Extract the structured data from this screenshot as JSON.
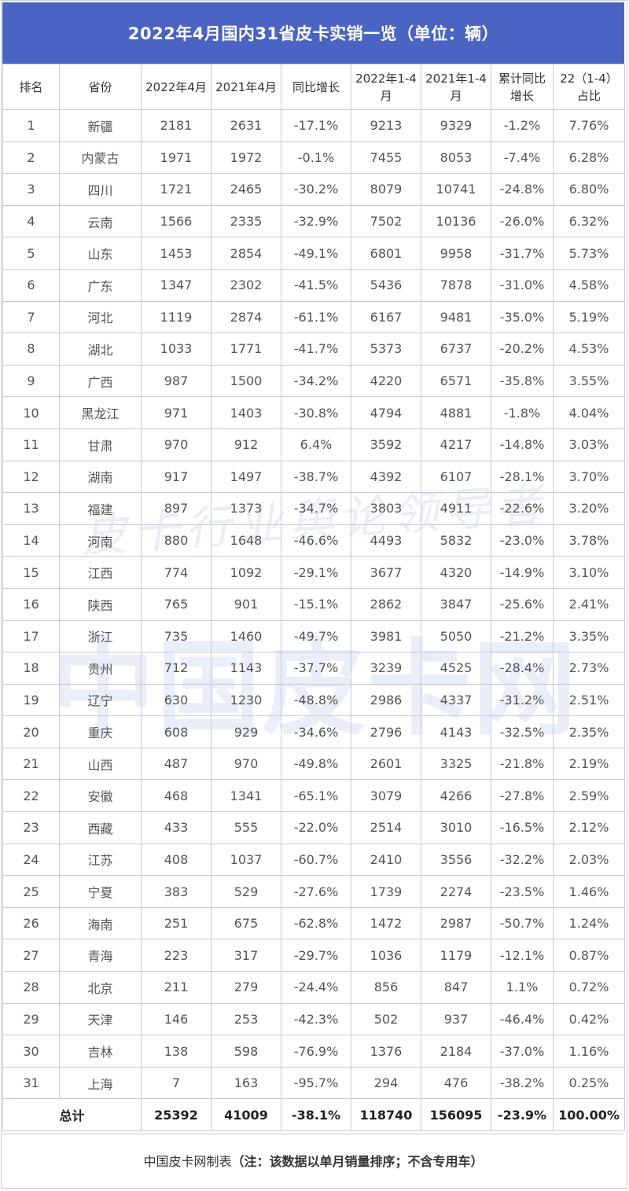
{
  "title": "2022年4月国内31省皮卡实销一览（单位：辆）",
  "watermark": {
    "brand": "中国皮卡网",
    "script": "皮卡行业舆论领导者"
  },
  "headers": [
    "排名",
    "省份",
    "2022年4月",
    "2021年4月",
    "同比增长",
    "2022年1-4月",
    "2021年1-4月",
    "累计同比增长",
    "22（1-4）占比"
  ],
  "rows": [
    {
      "rank": "1",
      "prov": "新疆",
      "m22": "2181",
      "m21": "2631",
      "yoy": "-17.1%",
      "c22": "9213",
      "c21": "9329",
      "cyoy": "-1.2%",
      "share": "7.76%"
    },
    {
      "rank": "2",
      "prov": "内蒙古",
      "m22": "1971",
      "m21": "1972",
      "yoy": "-0.1%",
      "c22": "7455",
      "c21": "8053",
      "cyoy": "-7.4%",
      "share": "6.28%"
    },
    {
      "rank": "3",
      "prov": "四川",
      "m22": "1721",
      "m21": "2465",
      "yoy": "-30.2%",
      "c22": "8079",
      "c21": "10741",
      "cyoy": "-24.8%",
      "share": "6.80%"
    },
    {
      "rank": "4",
      "prov": "云南",
      "m22": "1566",
      "m21": "2335",
      "yoy": "-32.9%",
      "c22": "7502",
      "c21": "10136",
      "cyoy": "-26.0%",
      "share": "6.32%"
    },
    {
      "rank": "5",
      "prov": "山东",
      "m22": "1453",
      "m21": "2854",
      "yoy": "-49.1%",
      "c22": "6801",
      "c21": "9958",
      "cyoy": "-31.7%",
      "share": "5.73%"
    },
    {
      "rank": "6",
      "prov": "广东",
      "m22": "1347",
      "m21": "2302",
      "yoy": "-41.5%",
      "c22": "5436",
      "c21": "7878",
      "cyoy": "-31.0%",
      "share": "4.58%"
    },
    {
      "rank": "7",
      "prov": "河北",
      "m22": "1119",
      "m21": "2874",
      "yoy": "-61.1%",
      "c22": "6167",
      "c21": "9481",
      "cyoy": "-35.0%",
      "share": "5.19%"
    },
    {
      "rank": "8",
      "prov": "湖北",
      "m22": "1033",
      "m21": "1771",
      "yoy": "-41.7%",
      "c22": "5373",
      "c21": "6737",
      "cyoy": "-20.2%",
      "share": "4.53%"
    },
    {
      "rank": "9",
      "prov": "广西",
      "m22": "987",
      "m21": "1500",
      "yoy": "-34.2%",
      "c22": "4220",
      "c21": "6571",
      "cyoy": "-35.8%",
      "share": "3.55%"
    },
    {
      "rank": "10",
      "prov": "黑龙江",
      "m22": "971",
      "m21": "1403",
      "yoy": "-30.8%",
      "c22": "4794",
      "c21": "4881",
      "cyoy": "-1.8%",
      "share": "4.04%"
    },
    {
      "rank": "11",
      "prov": "甘肃",
      "m22": "970",
      "m21": "912",
      "yoy": "6.4%",
      "c22": "3592",
      "c21": "4217",
      "cyoy": "-14.8%",
      "share": "3.03%"
    },
    {
      "rank": "12",
      "prov": "湖南",
      "m22": "917",
      "m21": "1497",
      "yoy": "-38.7%",
      "c22": "4392",
      "c21": "6107",
      "cyoy": "-28.1%",
      "share": "3.70%"
    },
    {
      "rank": "13",
      "prov": "福建",
      "m22": "897",
      "m21": "1373",
      "yoy": "-34.7%",
      "c22": "3803",
      "c21": "4911",
      "cyoy": "-22.6%",
      "share": "3.20%"
    },
    {
      "rank": "14",
      "prov": "河南",
      "m22": "880",
      "m21": "1648",
      "yoy": "-46.6%",
      "c22": "4493",
      "c21": "5832",
      "cyoy": "-23.0%",
      "share": "3.78%"
    },
    {
      "rank": "15",
      "prov": "江西",
      "m22": "774",
      "m21": "1092",
      "yoy": "-29.1%",
      "c22": "3677",
      "c21": "4320",
      "cyoy": "-14.9%",
      "share": "3.10%"
    },
    {
      "rank": "16",
      "prov": "陕西",
      "m22": "765",
      "m21": "901",
      "yoy": "-15.1%",
      "c22": "2862",
      "c21": "3847",
      "cyoy": "-25.6%",
      "share": "2.41%"
    },
    {
      "rank": "17",
      "prov": "浙江",
      "m22": "735",
      "m21": "1460",
      "yoy": "-49.7%",
      "c22": "3981",
      "c21": "5050",
      "cyoy": "-21.2%",
      "share": "3.35%"
    },
    {
      "rank": "18",
      "prov": "贵州",
      "m22": "712",
      "m21": "1143",
      "yoy": "-37.7%",
      "c22": "3239",
      "c21": "4525",
      "cyoy": "-28.4%",
      "share": "2.73%"
    },
    {
      "rank": "19",
      "prov": "辽宁",
      "m22": "630",
      "m21": "1230",
      "yoy": "-48.8%",
      "c22": "2986",
      "c21": "4337",
      "cyoy": "-31.2%",
      "share": "2.51%"
    },
    {
      "rank": "20",
      "prov": "重庆",
      "m22": "608",
      "m21": "929",
      "yoy": "-34.6%",
      "c22": "2796",
      "c21": "4143",
      "cyoy": "-32.5%",
      "share": "2.35%"
    },
    {
      "rank": "21",
      "prov": "山西",
      "m22": "487",
      "m21": "970",
      "yoy": "-49.8%",
      "c22": "2601",
      "c21": "3325",
      "cyoy": "-21.8%",
      "share": "2.19%"
    },
    {
      "rank": "22",
      "prov": "安徽",
      "m22": "468",
      "m21": "1341",
      "yoy": "-65.1%",
      "c22": "3079",
      "c21": "4266",
      "cyoy": "-27.8%",
      "share": "2.59%"
    },
    {
      "rank": "23",
      "prov": "西藏",
      "m22": "433",
      "m21": "555",
      "yoy": "-22.0%",
      "c22": "2514",
      "c21": "3010",
      "cyoy": "-16.5%",
      "share": "2.12%"
    },
    {
      "rank": "24",
      "prov": "江苏",
      "m22": "408",
      "m21": "1037",
      "yoy": "-60.7%",
      "c22": "2410",
      "c21": "3556",
      "cyoy": "-32.2%",
      "share": "2.03%"
    },
    {
      "rank": "25",
      "prov": "宁夏",
      "m22": "383",
      "m21": "529",
      "yoy": "-27.6%",
      "c22": "1739",
      "c21": "2274",
      "cyoy": "-23.5%",
      "share": "1.46%"
    },
    {
      "rank": "26",
      "prov": "海南",
      "m22": "251",
      "m21": "675",
      "yoy": "-62.8%",
      "c22": "1472",
      "c21": "2987",
      "cyoy": "-50.7%",
      "share": "1.24%"
    },
    {
      "rank": "27",
      "prov": "青海",
      "m22": "223",
      "m21": "317",
      "yoy": "-29.7%",
      "c22": "1036",
      "c21": "1179",
      "cyoy": "-12.1%",
      "share": "0.87%"
    },
    {
      "rank": "28",
      "prov": "北京",
      "m22": "211",
      "m21": "279",
      "yoy": "-24.4%",
      "c22": "856",
      "c21": "847",
      "cyoy": "1.1%",
      "share": "0.72%"
    },
    {
      "rank": "29",
      "prov": "天津",
      "m22": "146",
      "m21": "253",
      "yoy": "-42.3%",
      "c22": "502",
      "c21": "937",
      "cyoy": "-46.4%",
      "share": "0.42%"
    },
    {
      "rank": "30",
      "prov": "吉林",
      "m22": "138",
      "m21": "598",
      "yoy": "-76.9%",
      "c22": "1376",
      "c21": "2184",
      "cyoy": "-37.0%",
      "share": "1.16%"
    },
    {
      "rank": "31",
      "prov": "上海",
      "m22": "7",
      "m21": "163",
      "yoy": "-95.7%",
      "c22": "294",
      "c21": "476",
      "cyoy": "-38.2%",
      "share": "0.25%"
    }
  ],
  "total": {
    "label": "总计",
    "m22": "25392",
    "m21": "41009",
    "yoy": "-38.1%",
    "c22": "118740",
    "c21": "156095",
    "cyoy": "-23.9%",
    "share": "100.00%"
  },
  "footer": {
    "source": "中国皮卡网制表",
    "note": "（注：该数据以单月销量排序；不含专用车）"
  },
  "colors": {
    "header_bg": "#4a64c3",
    "negative": "#3d8b2f",
    "positive": "#e0201a",
    "border": "#c6cad4"
  }
}
